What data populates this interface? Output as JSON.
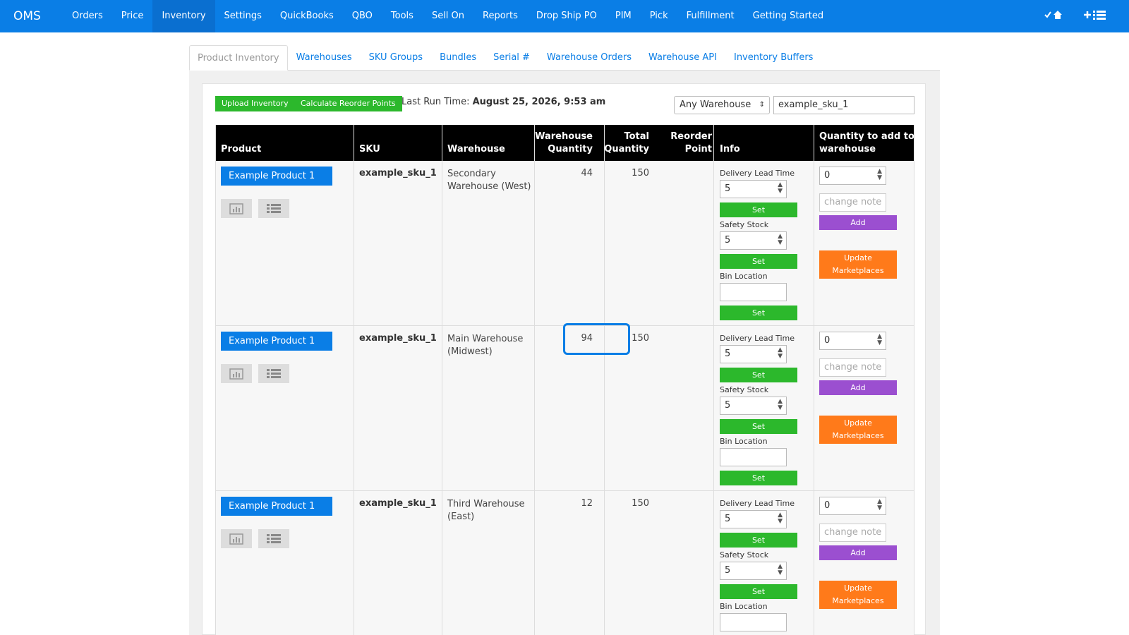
{
  "nav": {
    "brand": "OMS",
    "items": [
      "Orders",
      "Price",
      "Inventory",
      "Settings",
      "QuickBooks",
      "QBO",
      "Tools",
      "Sell On",
      "Reports",
      "Drop Ship PO",
      "PIM",
      "Pick",
      "Fulfillment",
      "Getting Started"
    ],
    "active": "Inventory",
    "right_icons": [
      "check-home-icon",
      "plus-list-icon"
    ]
  },
  "subtabs": {
    "items": [
      "Product Inventory",
      "Warehouses",
      "SKU Groups",
      "Bundles",
      "Serial #",
      "Warehouse Orders",
      "Warehouse API",
      "Inventory Buffers"
    ],
    "active": "Product Inventory"
  },
  "toolbar": {
    "upload_label": "Upload Inventory",
    "calc_label": "Calculate Reorder Points",
    "last_run_label": "Last Run Time:",
    "last_run_value": "August 25, 2026, 9:53 am",
    "warehouse_select": "Any Warehouse",
    "sku_search": "example_sku_1"
  },
  "table": {
    "headers": {
      "product": "Product",
      "sku": "SKU",
      "warehouse": "Warehouse",
      "wh_qty_1": "Warehouse",
      "wh_qty_2": "Quantity",
      "total_1": "Total",
      "total_2": "Quantity",
      "reorder_1": "Reorder",
      "reorder_2": "Point",
      "info": "Info",
      "qty_add_1": "Quantity to add to",
      "qty_add_2": "warehouse"
    },
    "labels": {
      "delivery": "Delivery Lead Time",
      "safety": "Safety Stock",
      "bin": "Bin Location",
      "set": "Set",
      "note_placeholder": "change note",
      "add": "Add",
      "update_1": "Update",
      "update_2": "Marketplaces"
    },
    "rows": [
      {
        "product": "Example Product 1",
        "sku": "example_sku_1",
        "warehouse": "Secondary Warehouse (West)",
        "wh_qty": "44",
        "total_qty": "150",
        "delivery": "5",
        "safety": "5",
        "qty_add": "0"
      },
      {
        "product": "Example Product 1",
        "sku": "example_sku_1",
        "warehouse": "Main Warehouse (Midwest)",
        "wh_qty": "94",
        "total_qty": "150",
        "delivery": "5",
        "safety": "5",
        "qty_add": "0"
      },
      {
        "product": "Example Product 1",
        "sku": "example_sku_1",
        "warehouse": "Third Warehouse (East)",
        "wh_qty": "12",
        "total_qty": "150",
        "delivery": "5",
        "safety": "5",
        "qty_add": "0"
      }
    ]
  }
}
